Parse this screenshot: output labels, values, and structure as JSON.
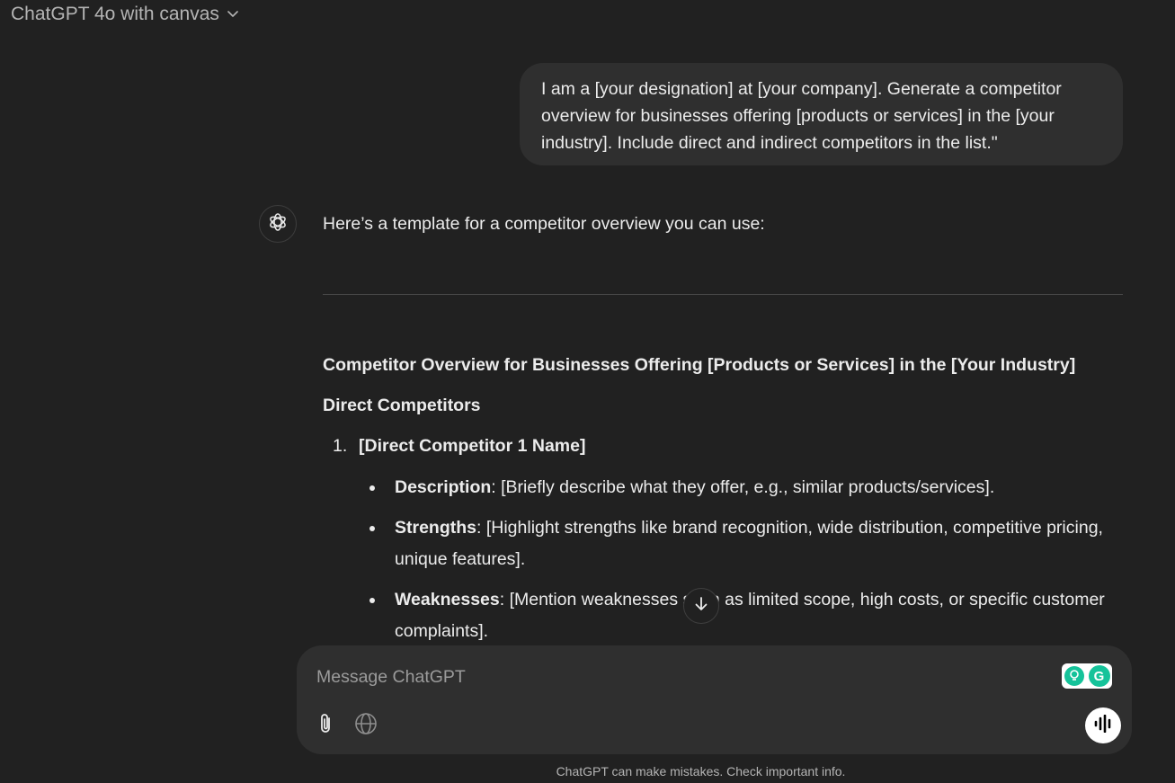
{
  "header": {
    "model_name": "ChatGPT 4o with canvas",
    "dropdown_icon": "chevron-down-icon"
  },
  "user_message": {
    "text": "I am a [your designation] at [your company]. Generate a competitor overview for businesses offering [products or services] in the [your industry]. Include direct and indirect competitors in the list.\""
  },
  "assistant": {
    "avatar_icon": "openai-logo-icon",
    "intro": "Here’s a template for a competitor overview you can use:",
    "doc_title": "Competitor Overview for Businesses Offering [Products or Services] in the [Your Industry]",
    "section_heading": "Direct Competitors",
    "ordered_items": [
      {
        "number": "1.",
        "label": "[Direct Competitor 1 Name]"
      }
    ],
    "bullets": [
      {
        "label": "Description",
        "text": ": [Briefly describe what they offer, e.g., similar products/services]."
      },
      {
        "label": "Strengths",
        "text": ": [Highlight strengths like brand recognition, wide distribution, competitive pricing, unique features]."
      },
      {
        "label": "Weaknesses",
        "text": ": [Mention weaknesses such as limited scope, high costs, or specific customer complaints]."
      }
    ]
  },
  "scroll_button": {
    "icon": "arrow-down-icon"
  },
  "composer": {
    "placeholder": "Message ChatGPT",
    "attach_icon": "paperclip-icon",
    "search_icon": "globe-icon",
    "voice_icon": "voice-waveform-icon",
    "grammarly_badge": "G"
  },
  "footer": {
    "disclaimer": "ChatGPT can make mistakes. Check important info."
  },
  "colors": {
    "background": "#212121",
    "bubble": "#2f2f2f",
    "text": "#ececec",
    "muted": "#b4b4b4",
    "grammarly_green": "#15c39a"
  }
}
